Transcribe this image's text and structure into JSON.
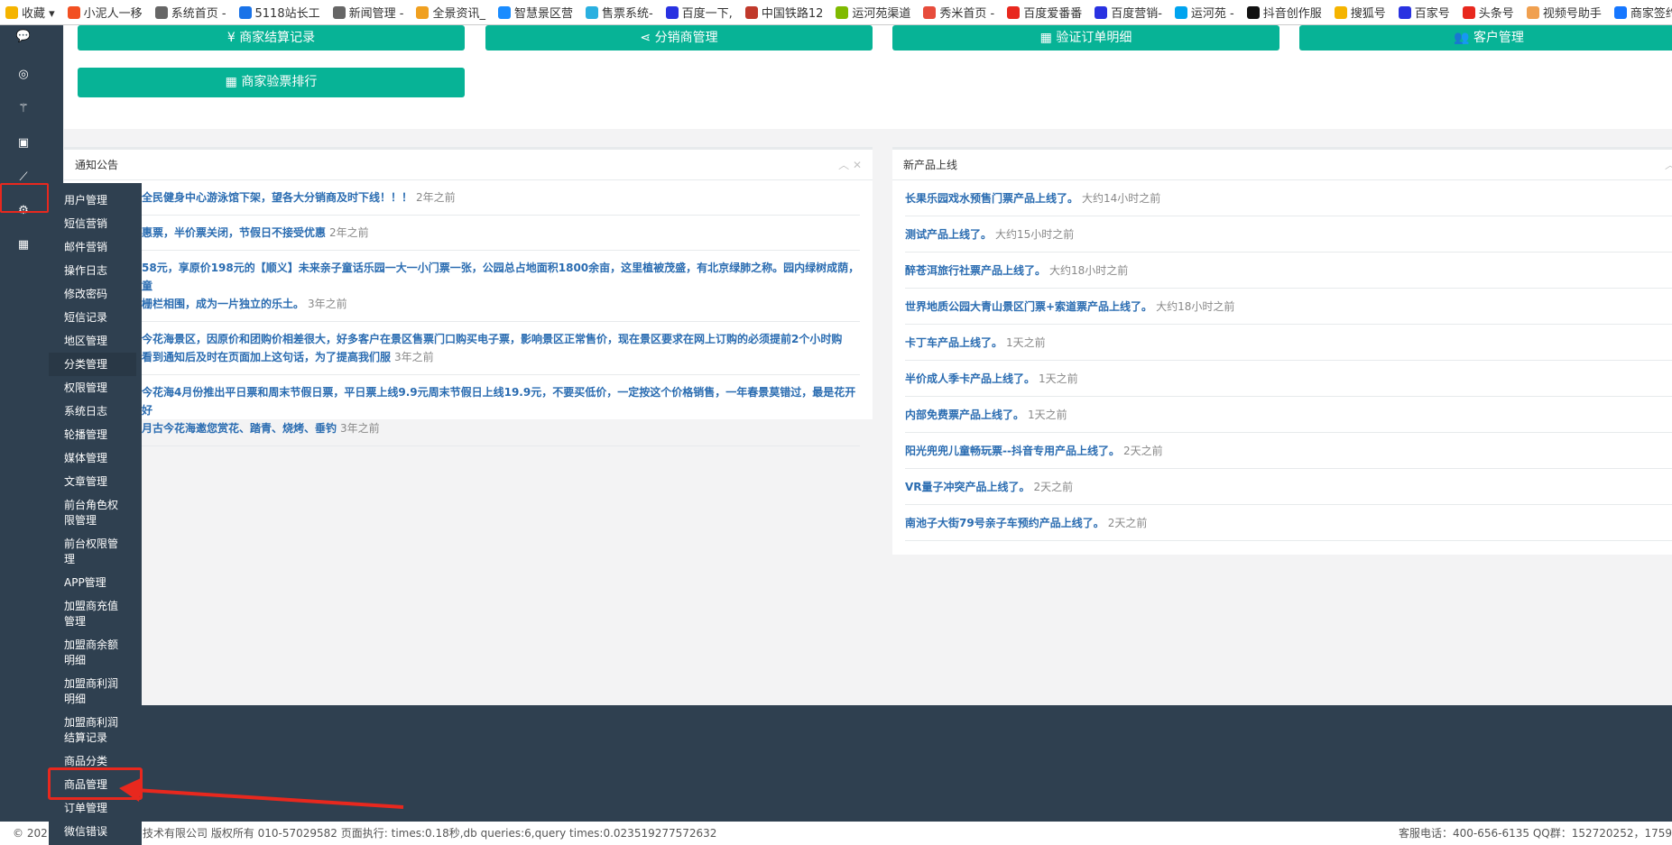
{
  "bookmarks": [
    {
      "label": "收藏 ▾",
      "color": "#f5b400",
      "icon": "star-icon"
    },
    {
      "label": "小泥人一移",
      "color": "#f25022",
      "icon": "windows-icon"
    },
    {
      "label": "系统首页 -",
      "color": "#666666",
      "icon": "page-icon"
    },
    {
      "label": "5118站长工",
      "color": "#1a73e8",
      "icon": "5118-icon"
    },
    {
      "label": "新闻管理 -",
      "color": "#666666",
      "icon": "page-icon"
    },
    {
      "label": "全景资讯_",
      "color": "#f0a020",
      "icon": "panorama-icon"
    },
    {
      "label": "智慧景区营",
      "color": "#1a8cff",
      "icon": "app-icon"
    },
    {
      "label": "售票系统-",
      "color": "#2ab0e0",
      "icon": "ticket-icon"
    },
    {
      "label": "百度一下,",
      "color": "#2932e1",
      "icon": "baidu-icon"
    },
    {
      "label": "中国铁路12",
      "color": "#c0392b",
      "icon": "railway-icon"
    },
    {
      "label": "运河苑渠道",
      "color": "#7fba00",
      "icon": "windows-icon"
    },
    {
      "label": "秀米首页 -",
      "color": "#e74c3c",
      "icon": "xiumi-icon"
    },
    {
      "label": "百度爱番番",
      "color": "#e8281e",
      "icon": "aifanfan-icon"
    },
    {
      "label": "百度营销-",
      "color": "#2932e1",
      "icon": "baidu-marketing-icon"
    },
    {
      "label": "运河苑 -",
      "color": "#00a4ef",
      "icon": "windows-icon"
    },
    {
      "label": "抖音创作服",
      "color": "#111111",
      "icon": "douyin-icon"
    },
    {
      "label": "搜狐号",
      "color": "#f5b400",
      "icon": "sohu-icon"
    },
    {
      "label": "百家号",
      "color": "#2932e1",
      "icon": "baijiahao-icon"
    },
    {
      "label": "头条号",
      "color": "#e8281e",
      "icon": "toutiao-icon"
    },
    {
      "label": "视频号助手",
      "color": "#f0a050",
      "icon": "channels-icon"
    },
    {
      "label": "商家签约管",
      "color": "#1677ff",
      "icon": "alipay-icon"
    }
  ],
  "buttons": [
    {
      "icon": "¥",
      "label": "商家结算记录"
    },
    {
      "icon": "⋖",
      "label": "分销商管理"
    },
    {
      "icon": "▦",
      "label": "验证订单明细"
    },
    {
      "icon": "👥",
      "label": "客户管理"
    },
    {
      "icon": "▦",
      "label": "商家验票排行"
    }
  ],
  "accent": "#07b396",
  "notice": {
    "title": "通知公告",
    "items": [
      {
        "lines": [
          "全民健身中心游泳馆下架，望各大分销商及时下线！！！"
        ],
        "time": "2年之前"
      },
      {
        "lines": [
          "惠票，半价票关闭，节假日不接受优惠"
        ],
        "time": "2年之前"
      },
      {
        "lines": [
          "58元，享原价198元的【顺义】未来亲子童话乐园一大一小门票一张，公园总占地面积1800余亩，这里植被茂盛，有北京绿肺之称。园内绿树成荫，童",
          "栅栏相围，成为一片独立的乐土。"
        ],
        "time": "3年之前"
      },
      {
        "lines": [
          "今花海景区，因原价和团购价相差很大，好多客户在景区售票门口购买电子票，影响景区正常售价，现在景区要求在网上订购的必须提前2个小时购",
          "看到通知后及时在页面加上这句话，为了提高我们服"
        ],
        "time": "3年之前"
      },
      {
        "lines": [
          "今花海4月份推出平日票和周末节假日票，平日票上线9.9元周末节假日上线19.9元，不要买低价，一定按这个价格销售，一年春景莫错过，最是花开好",
          "月古今花海邀您赏花、踏青、烧烤、垂钓"
        ],
        "time": "3年之前"
      }
    ]
  },
  "products": {
    "title": "新产品上线",
    "items": [
      {
        "text": "长果乐园戏水预售门票产品上线了。",
        "time": "大约14小时之前"
      },
      {
        "text": "测试产品上线了。",
        "time": "大约15小时之前"
      },
      {
        "text": "醉苍洱旅行社票产品上线了。",
        "time": "大约18小时之前"
      },
      {
        "text": "世界地质公园大青山景区门票+索道票产品上线了。",
        "time": "大约18小时之前"
      },
      {
        "text": "卡丁车产品上线了。",
        "time": "1天之前"
      },
      {
        "text": "半价成人季卡产品上线了。",
        "time": "1天之前"
      },
      {
        "text": "内部免费票产品上线了。",
        "time": "1天之前"
      },
      {
        "text": "阳光兜兜儿童畅玩票--抖音专用产品上线了。",
        "time": "2天之前"
      },
      {
        "text": "VR量子冲突产品上线了。",
        "time": "2天之前"
      },
      {
        "text": "南池子大街79号亲子车预约产品上线了。",
        "time": "2天之前"
      }
    ]
  },
  "menu": {
    "selected": "分类管理",
    "highlighted": "商品管理",
    "items": [
      "用户管理",
      "短信营销",
      "邮件营销",
      "操作日志",
      "修改密码",
      "短信记录",
      "地区管理",
      "分类管理",
      "权限管理",
      "系统日志",
      "轮播管理",
      "媒体管理",
      "文章管理",
      "前台角色权限管理",
      "前台权限管理",
      "APP管理",
      "加盟商充值管理",
      "加盟商余额明细",
      "加盟商利润明细",
      "加盟商利润结算记录",
      "商品分类",
      "商品管理",
      "订单管理",
      "微信错误"
    ]
  },
  "rail_icons": [
    "wechat-icon",
    "mini-program-icon",
    "magic-wand-icon",
    "gift-icon",
    "line-chart-icon",
    "gears-icon",
    "grid-icon"
  ],
  "footer": {
    "left_a": "© 202",
    "left_b": "技术有限公司 版权所有 010-57029582 页面执行: times:0.18秒,db queries:6,query times:0.023519277572632",
    "right": "客服电话：400-656-6135 QQ群：152720252，1759"
  }
}
